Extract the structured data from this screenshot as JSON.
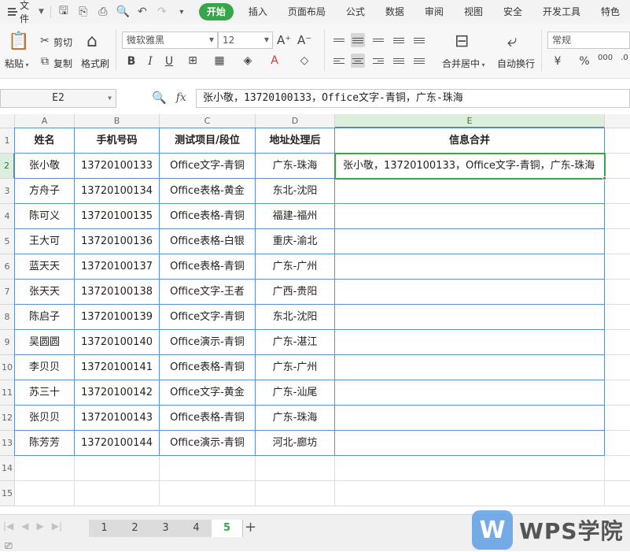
{
  "menubar": {
    "file_label": "文件",
    "tabs": [
      "开始",
      "插入",
      "页面布局",
      "公式",
      "数据",
      "审阅",
      "视图",
      "安全",
      "开发工具",
      "特色"
    ]
  },
  "ribbon": {
    "paste": "粘贴",
    "cut": "剪切",
    "copy": "复制",
    "format_painter": "格式刷",
    "font_name": "微软雅黑",
    "font_size": "12",
    "merge_center": "合并居中",
    "wrap_text": "自动换行",
    "number_format": "常规",
    "icons": [
      "paste-icon",
      "scissors-icon",
      "copy-icon",
      "format-painter-icon",
      "bold-icon",
      "italic-icon",
      "underline-icon",
      "border-icon",
      "fill-color-icon",
      "font-color-icon",
      "clear-icon",
      "merge-center-icon",
      "wrap-text-icon",
      "currency-icon",
      "percent-icon"
    ]
  },
  "formula": {
    "name_box": "E2",
    "fx": "fx",
    "content": "张小敬，13720100133，Office文字-青铜，广东-珠海"
  },
  "grid": {
    "columns": [
      "A",
      "B",
      "C",
      "D",
      "E"
    ],
    "rows": [
      "1",
      "2",
      "3",
      "4",
      "5",
      "6",
      "7",
      "8",
      "9",
      "10",
      "11",
      "12",
      "13",
      "14",
      "15"
    ],
    "headers": [
      "姓名",
      "手机号码",
      "测试项目/段位",
      "地址处理后",
      "信息合并"
    ],
    "data": [
      [
        "张小敬",
        "13720100133",
        "Office文字-青铜",
        "广东-珠海",
        "张小敬，13720100133，Office文字-青铜，广东-珠海"
      ],
      [
        "方舟子",
        "13720100134",
        "Office表格-黄金",
        "东北-沈阳",
        ""
      ],
      [
        "陈可义",
        "13720100135",
        "Office表格-青铜",
        "福建-福州",
        ""
      ],
      [
        "王大可",
        "13720100136",
        "Office表格-白银",
        "重庆-渝北",
        ""
      ],
      [
        "蓝天天",
        "13720100137",
        "Office表格-青铜",
        "广东-广州",
        ""
      ],
      [
        "张天天",
        "13720100138",
        "Office文字-王者",
        "广西-贵阳",
        ""
      ],
      [
        "陈启子",
        "13720100139",
        "Office文字-青铜",
        "东北-沈阳",
        ""
      ],
      [
        "吴圆圆",
        "13720100140",
        "Office演示-青铜",
        "广东-湛江",
        ""
      ],
      [
        "李贝贝",
        "13720100141",
        "Office表格-青铜",
        "广东-广州",
        ""
      ],
      [
        "苏三十",
        "13720100142",
        "Office文字-黄金",
        "广东-汕尾",
        ""
      ],
      [
        "张贝贝",
        "13720100143",
        "Office表格-青铜",
        "广东-珠海",
        ""
      ],
      [
        "陈芳芳",
        "13720100144",
        "Office演示-青铜",
        "河北-廊坊",
        ""
      ]
    ]
  },
  "sheets": {
    "tabs": [
      "1",
      "2",
      "3",
      "4",
      "5"
    ],
    "active": "5",
    "add": "+"
  },
  "watermark": {
    "mark": "W",
    "text": "WPS学院"
  },
  "colors": {
    "accent_green": "#39a54b",
    "table_border_blue": "#5b8ed6"
  }
}
